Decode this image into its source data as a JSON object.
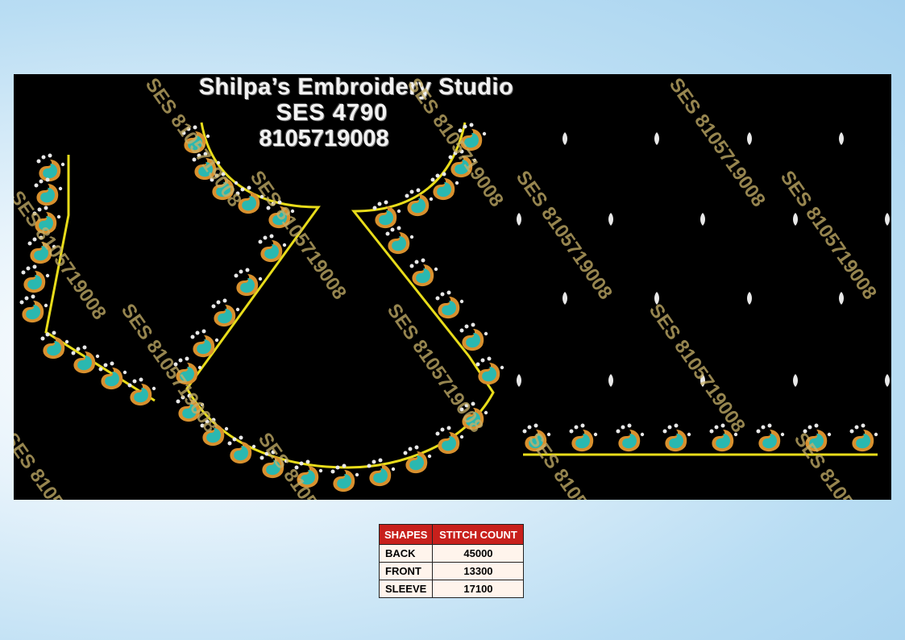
{
  "design": {
    "title_line1": "Shilpa’s Embroidery Studio",
    "title_line2": "SES  4790",
    "title_line3": "8105719008",
    "watermark_text": "SES 8105719008",
    "colors": {
      "background": "#000000",
      "outline": "#e8dc1a",
      "motif_fill": "#2ab8b0",
      "motif_border": "#d8902e",
      "petal": "#e8e8e8"
    }
  },
  "stitch_table": {
    "header_shapes": "SHAPES",
    "header_count": "STITCH COUNT",
    "rows": [
      {
        "shape": "BACK",
        "count": "45000"
      },
      {
        "shape": "FRONT",
        "count": "13300"
      },
      {
        "shape": "SLEEVE",
        "count": "17100"
      }
    ]
  }
}
